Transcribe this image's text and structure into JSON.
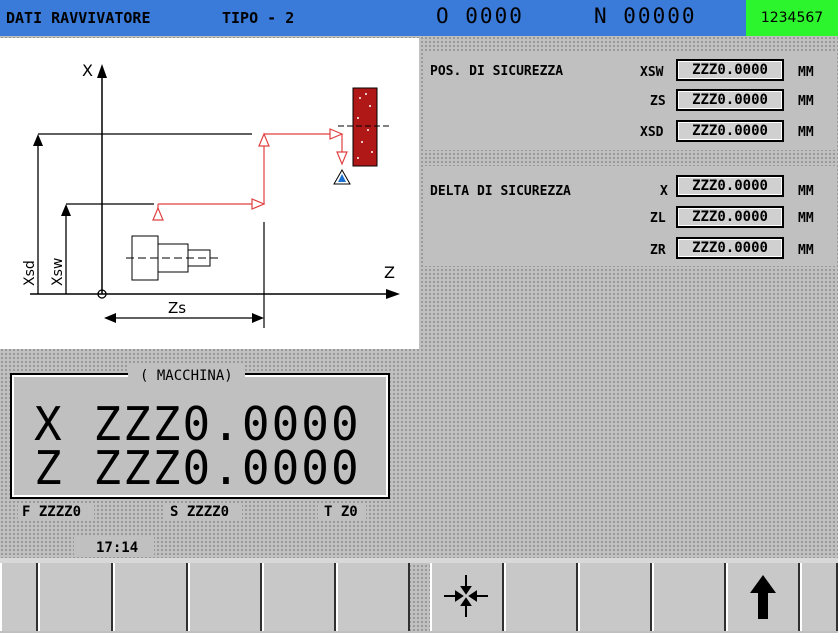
{
  "header": {
    "title": "DATI RAVVIVATORE",
    "tipo": "TIPO - 2",
    "o_field": "O 0000",
    "n_field": "N 00000",
    "id_box": "1234567"
  },
  "diagram": {
    "axis_x": "X",
    "axis_z": "Z",
    "label_xsd": "Xsd",
    "label_xsw": "Xsw",
    "label_zs": "Zs"
  },
  "safety_position": {
    "title": "POS. DI SICUREZZA",
    "rows": [
      {
        "label": "XSW",
        "value": "ZZZ0.0000",
        "unit": "MM"
      },
      {
        "label": "ZS",
        "value": "ZZZ0.0000",
        "unit": "MM"
      },
      {
        "label": "XSD",
        "value": "ZZZ0.0000",
        "unit": "MM"
      }
    ]
  },
  "safety_delta": {
    "title": "DELTA DI SICUREZZA",
    "rows": [
      {
        "label": "X",
        "value": "ZZZ0.0000",
        "unit": "MM"
      },
      {
        "label": "ZL",
        "value": "ZZZ0.0000",
        "unit": "MM"
      },
      {
        "label": "ZR",
        "value": "ZZZ0.0000",
        "unit": "MM"
      }
    ]
  },
  "machine": {
    "title": "( MACCHINA)",
    "x_axis": "X",
    "x_value": "ZZZ0.0000",
    "z_axis": "Z",
    "z_value": "ZZZ0.0000"
  },
  "status": {
    "feed": "F ZZZZ0",
    "speed": "S ZZZZ0",
    "tool": "T Z0",
    "time": "17:14"
  },
  "softkeys": {
    "icons": [
      "",
      "",
      "",
      "",
      "",
      "",
      "move-center-icon",
      "",
      "",
      "",
      "up-arrow-icon"
    ]
  }
}
